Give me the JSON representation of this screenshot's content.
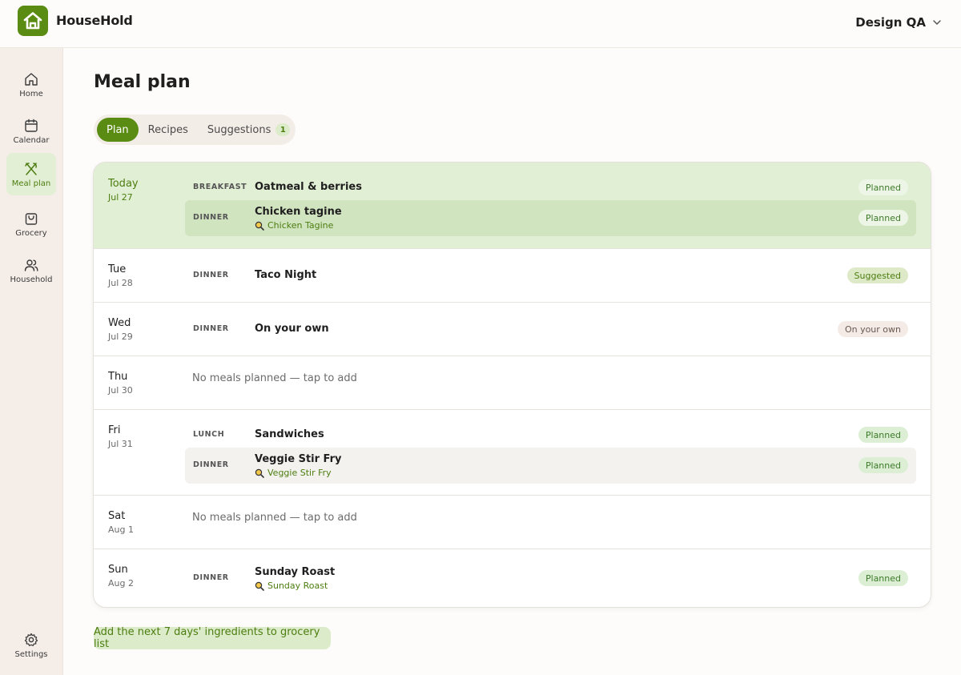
{
  "app": {
    "name": "HouseHold"
  },
  "account": {
    "name": "Design QA"
  },
  "sidebar": {
    "items": [
      {
        "label": "Home",
        "icon": "home-icon"
      },
      {
        "label": "Calendar",
        "icon": "calendar-icon"
      },
      {
        "label": "Meal plan",
        "icon": "utensils-icon",
        "active": true
      },
      {
        "label": "Grocery",
        "icon": "shopping-bag-icon"
      },
      {
        "label": "Household",
        "icon": "users-icon"
      }
    ],
    "settings": {
      "label": "Settings",
      "icon": "gear-icon"
    }
  },
  "page": {
    "title": "Meal plan"
  },
  "tabs": [
    {
      "label": "Plan",
      "active": true
    },
    {
      "label": "Recipes"
    },
    {
      "label": "Suggestions",
      "badge": "1"
    }
  ],
  "days": [
    {
      "name": "Today",
      "date": "Jul 27",
      "today": true,
      "meals": [
        {
          "type": "BREAKFAST",
          "name": "Oatmeal & berries",
          "status": "Planned"
        },
        {
          "type": "DINNER",
          "name": "Chicken tagine",
          "recipe": "Chicken Tagine",
          "status": "Planned"
        }
      ]
    },
    {
      "name": "Tue",
      "date": "Jul 28",
      "meals": [
        {
          "type": "DINNER",
          "name": "Taco Night",
          "status": "Suggested"
        }
      ]
    },
    {
      "name": "Wed",
      "date": "Jul 29",
      "meals": [
        {
          "type": "DINNER",
          "name": "On your own",
          "status": "On your own"
        }
      ]
    },
    {
      "name": "Thu",
      "date": "Jul 30",
      "empty": "No meals planned — tap to add"
    },
    {
      "name": "Fri",
      "date": "Jul 31",
      "meals": [
        {
          "type": "LUNCH",
          "name": "Sandwiches",
          "status": "Planned"
        },
        {
          "type": "DINNER",
          "name": "Veggie Stir Fry",
          "recipe": "Veggie Stir Fry",
          "status": "Planned"
        }
      ]
    },
    {
      "name": "Sat",
      "date": "Aug 1",
      "empty": "No meals planned — tap to add"
    },
    {
      "name": "Sun",
      "date": "Aug 2",
      "meals": [
        {
          "type": "DINNER",
          "name": "Sunday Roast",
          "recipe": "Sunday Roast",
          "status": "Planned"
        }
      ]
    }
  ],
  "actions": {
    "grocery": "Add the next 7 days' ingredients to grocery list"
  },
  "colors": {
    "brand": "#5a8c14",
    "today_bg": "#e1efd4",
    "sidebar_bg": "#f5ede8"
  }
}
